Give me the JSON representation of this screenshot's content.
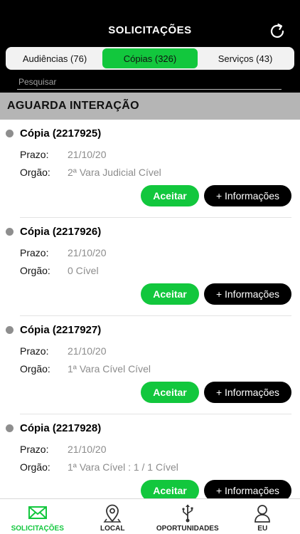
{
  "header": {
    "title": "SOLICITAÇÕES",
    "refresh_icon": "refresh-icon"
  },
  "tabs": [
    {
      "label": "Audiências (76)",
      "active": false
    },
    {
      "label": "Cópias (326)",
      "active": true
    },
    {
      "label": "Serviços (43)",
      "active": false
    }
  ],
  "search": {
    "placeholder": "Pesquisar",
    "value": ""
  },
  "section": {
    "title": "AGUARDA INTERAÇÃO"
  },
  "labels": {
    "prazo": "Prazo:",
    "orgao": "Orgão:",
    "accept": "Aceitar",
    "info": "+ Informações"
  },
  "items": [
    {
      "title": "Cópia (2217925)",
      "prazo": "21/10/20",
      "orgao": "2ª Vara Judicial Cível"
    },
    {
      "title": "Cópia (2217926)",
      "prazo": "21/10/20",
      "orgao": "0 Cível"
    },
    {
      "title": "Cópia (2217927)",
      "prazo": "21/10/20",
      "orgao": "1ª Vara Cível Cível"
    },
    {
      "title": "Cópia (2217928)",
      "prazo": "21/10/20",
      "orgao": "1ª Vara Cível : 1 / 1 Cível"
    }
  ],
  "bottom_nav": [
    {
      "label": "SOLICITAÇÕES",
      "icon": "envelope-icon",
      "active": true
    },
    {
      "label": "LOCAL",
      "icon": "map-pin-icon",
      "active": false
    },
    {
      "label": "OPORTUNIDADES",
      "icon": "usb-icon",
      "active": false
    },
    {
      "label": "EU",
      "icon": "user-icon",
      "active": false
    }
  ],
  "colors": {
    "accent": "#12c73d",
    "header_bg": "#000000",
    "section_bg": "#b5b5b5"
  }
}
